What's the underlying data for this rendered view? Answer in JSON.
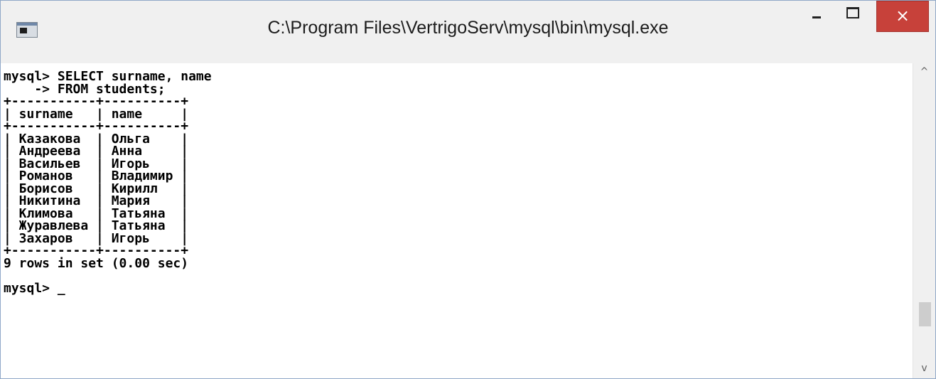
{
  "window": {
    "title": "C:\\Program Files\\VertrigoServ\\mysql\\bin\\mysql.exe",
    "close_glyph": "×",
    "icon": "console-app-icon"
  },
  "console": {
    "lines": [
      "mysql> SELECT surname, name",
      "    -> FROM students;",
      "+-----------+----------+",
      "| surname   | name     |",
      "+-----------+----------+",
      "| Казакова  | Ольга    |",
      "| Андреева  | Анна     |",
      "| Васильев  | Игорь    |",
      "| Романов   | Владимир |",
      "| Борисов   | Кирилл   |",
      "| Никитина  | Мария    |",
      "| Климова   | Татьяна  |",
      "| Журавлева | Татьяна  |",
      "| Захаров   | Игорь    |",
      "+-----------+----------+",
      "9 rows in set (0.00 sec)",
      "",
      "mysql> _"
    ]
  },
  "scrollbar": {
    "up_glyph": "^",
    "down_glyph": "v"
  },
  "colors": {
    "close_button": "#c7413a",
    "titlebar": "#f0f0f0",
    "console_bg": "#ffffff",
    "console_text": "#000000"
  }
}
